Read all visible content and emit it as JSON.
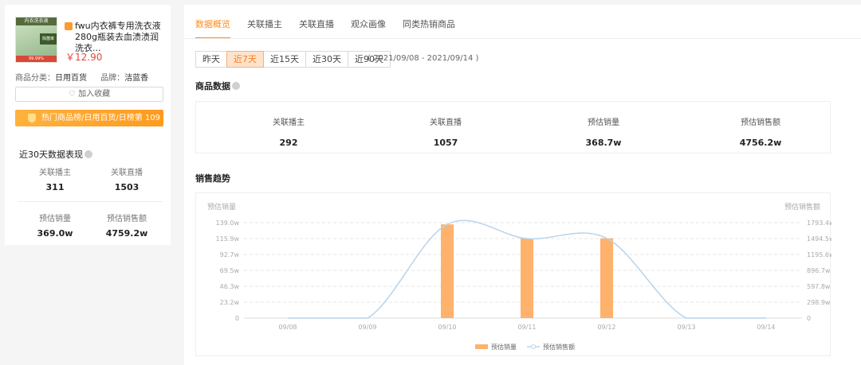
{
  "product": {
    "thumb_tag": "内衣洗衣液",
    "thumb_badge": "除菌率",
    "thumb_strip": "99.99%",
    "title": "fwu内衣裤专用洗衣液280g瓶装去血渍渍润洗衣...",
    "price": "￥12.90",
    "category_label": "商品分类：",
    "category_value": "日用百货",
    "brand_label": "品牌：",
    "brand_value": "洁蓝香",
    "fav_label": "加入收藏",
    "rank_text": "热门商品榜/日用百货/日榜第 109"
  },
  "recent30": {
    "title": "近30天数据表现",
    "stats": [
      {
        "label": "关联播主",
        "value": "311"
      },
      {
        "label": "关联直播",
        "value": "1503"
      },
      {
        "label": "预估销量",
        "value": "369.0w"
      },
      {
        "label": "预估销售额",
        "value": "4759.2w"
      }
    ]
  },
  "tabs": [
    "数据概览",
    "关联播主",
    "关联直播",
    "观众画像",
    "同类热销商品"
  ],
  "active_tab": 0,
  "ranges": [
    "昨天",
    "近7天",
    "近15天",
    "近30天",
    "近90天"
  ],
  "active_range": 1,
  "range_text": "( 2021/09/08 - 2021/09/14 )",
  "product_data": {
    "title": "商品数据",
    "kpis": [
      {
        "label": "关联播主",
        "value": "292"
      },
      {
        "label": "关联直播",
        "value": "1057"
      },
      {
        "label": "预估销量",
        "value": "368.7w"
      },
      {
        "label": "预估销售额",
        "value": "4756.2w"
      }
    ]
  },
  "sales_trend": {
    "title": "销售趋势"
  },
  "chart_data": {
    "type": "bar",
    "categories": [
      "09/08",
      "09/09",
      "09/10",
      "09/11",
      "09/12",
      "09/13",
      "09/14"
    ],
    "ylabel": "预估销量",
    "y2label": "预估销售额",
    "yticks": [
      "0",
      "23.2w",
      "46.3w",
      "69.5w",
      "92.7w",
      "115.9w",
      "139.0w"
    ],
    "y2ticks": [
      "0",
      "298.9w",
      "597.8w",
      "896.7w",
      "1195.6w",
      "1494.5w",
      "1793.4w"
    ],
    "ylim": [
      0,
      139.0
    ],
    "y2lim": [
      0,
      1793.4
    ],
    "series": [
      {
        "name": "预估销量",
        "type": "bar",
        "color": "#ffb26b",
        "values": [
          0,
          0,
          136.5,
          116.0,
          116.2,
          0,
          0
        ]
      },
      {
        "name": "预估销售额",
        "type": "line",
        "color": "#b8d4ec",
        "values": [
          0,
          0,
          1763,
          1494,
          1498,
          0,
          0
        ]
      }
    ],
    "legend": "bottom",
    "grid": true
  }
}
